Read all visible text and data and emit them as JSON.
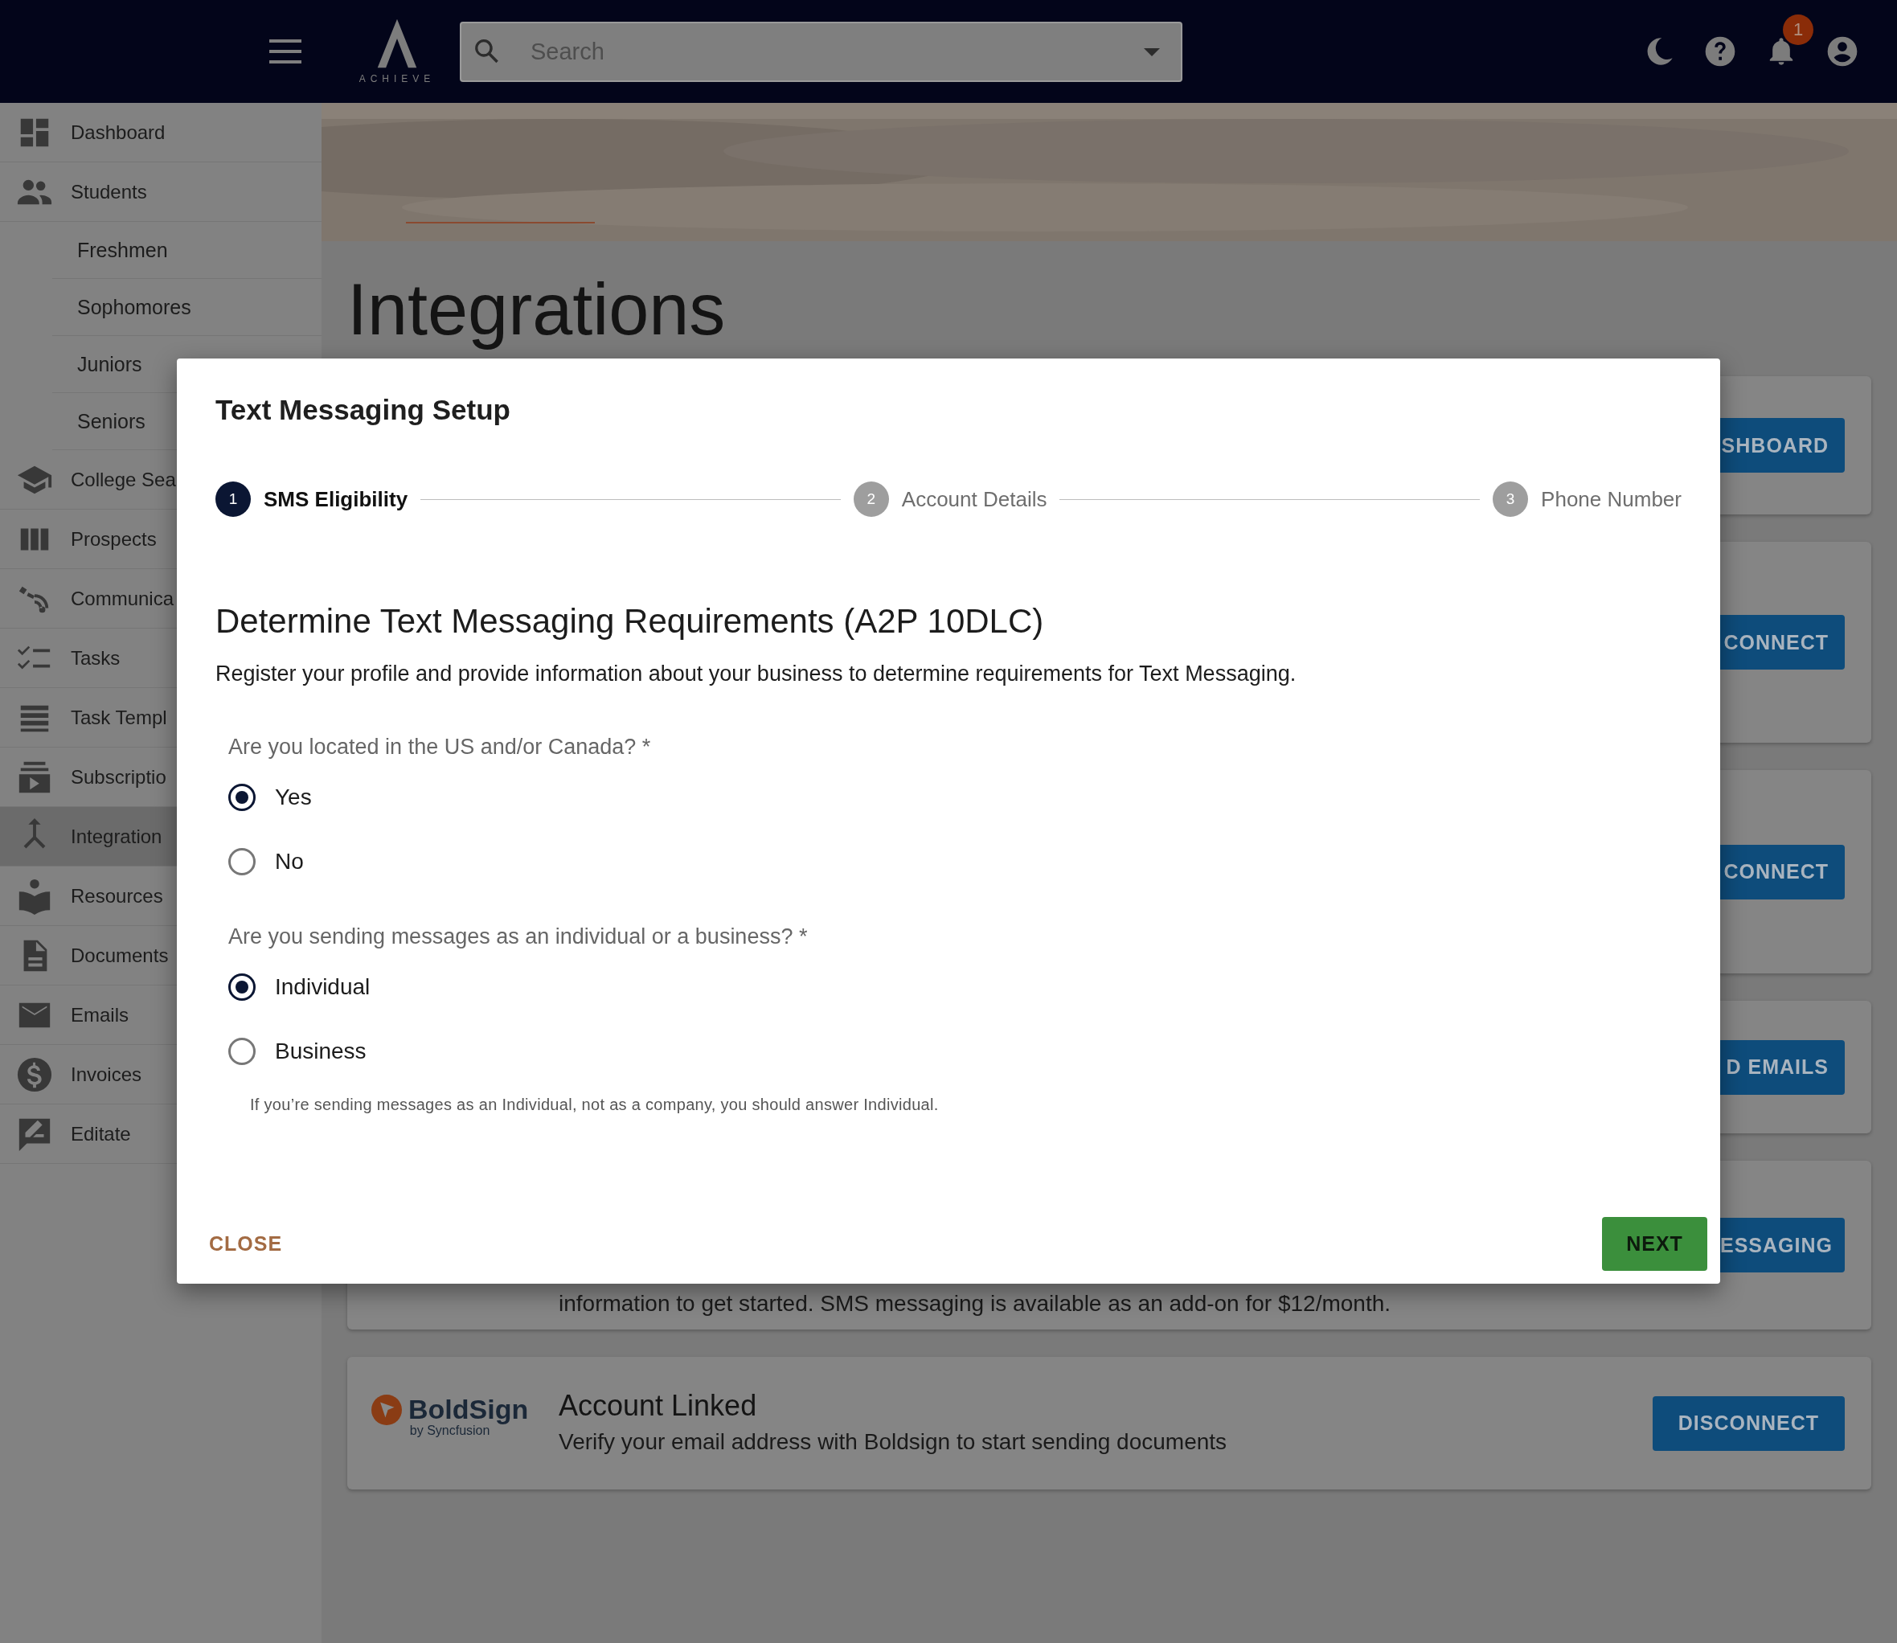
{
  "header": {
    "logo": "ACHIEVE",
    "search": {
      "placeholder": "Search"
    },
    "notifications": "1"
  },
  "sidebar": {
    "items": [
      {
        "label": "Dashboard",
        "selected": false
      },
      {
        "label": "Students",
        "selected": false,
        "children": [
          {
            "label": "Freshmen",
            "selected": false
          },
          {
            "label": "Sophomores",
            "selected": false
          },
          {
            "label": "Juniors",
            "selected": false
          },
          {
            "label": "Seniors",
            "selected": false
          }
        ]
      },
      {
        "label": "College Sea",
        "selected": false
      },
      {
        "label": "Prospects",
        "selected": false
      },
      {
        "label": "Communica",
        "selected": false
      },
      {
        "label": "Tasks",
        "selected": false
      },
      {
        "label": "Task Templ",
        "selected": false
      },
      {
        "label": "Subscriptio",
        "selected": false
      },
      {
        "label": "Integration",
        "selected": true
      },
      {
        "label": "Resources",
        "selected": false
      },
      {
        "label": "Documents",
        "selected": false
      },
      {
        "label": "Emails",
        "selected": false
      },
      {
        "label": "Invoices",
        "selected": false
      },
      {
        "label": "Editate",
        "selected": false
      }
    ]
  },
  "page": {
    "title": "Integrations",
    "cards": [
      {
        "kind": "partial",
        "button": "SHBOARD"
      },
      {
        "kind": "partial",
        "button": "CONNECT"
      },
      {
        "kind": "partial",
        "button": "CONNECT"
      },
      {
        "kind": "partial",
        "button": "D EMAILS"
      },
      {
        "kind": "partial",
        "button": "ESSAGING",
        "text": "information to get started. SMS messaging is available as an add-on for $12/month."
      },
      {
        "kind": "full",
        "logo": "BoldSign",
        "logo_sub": "by Syncfusion",
        "title": "Account Linked",
        "text": "Verify your email address with Boldsign to start sending documents",
        "button": "DISCONNECT"
      }
    ]
  },
  "dialog": {
    "title": "Text Messaging Setup",
    "steps": [
      {
        "number": "1",
        "label": "SMS Eligibility",
        "selected": true
      },
      {
        "number": "2",
        "label": "Account Details",
        "selected": false
      },
      {
        "number": "3",
        "label": "Phone Number",
        "selected": false
      }
    ],
    "heading": "Determine Text Messaging Requirements (A2P 10DLC)",
    "description": "Register your profile and provide information about your business to determine requirements for Text Messaging.",
    "questions": [
      {
        "label": "Are you located in the US and/or Canada? *",
        "options": [
          {
            "label": "Yes",
            "selected": true
          },
          {
            "label": "No",
            "selected": false
          }
        ]
      },
      {
        "label": "Are you sending messages as an individual or a business? *",
        "options": [
          {
            "label": "Individual",
            "selected": true
          },
          {
            "label": "Business",
            "selected": false
          }
        ],
        "hint": "If you’re sending messages as an Individual, not as a company, you should answer Individual."
      }
    ],
    "close": "CLOSE",
    "next": "NEXT"
  }
}
